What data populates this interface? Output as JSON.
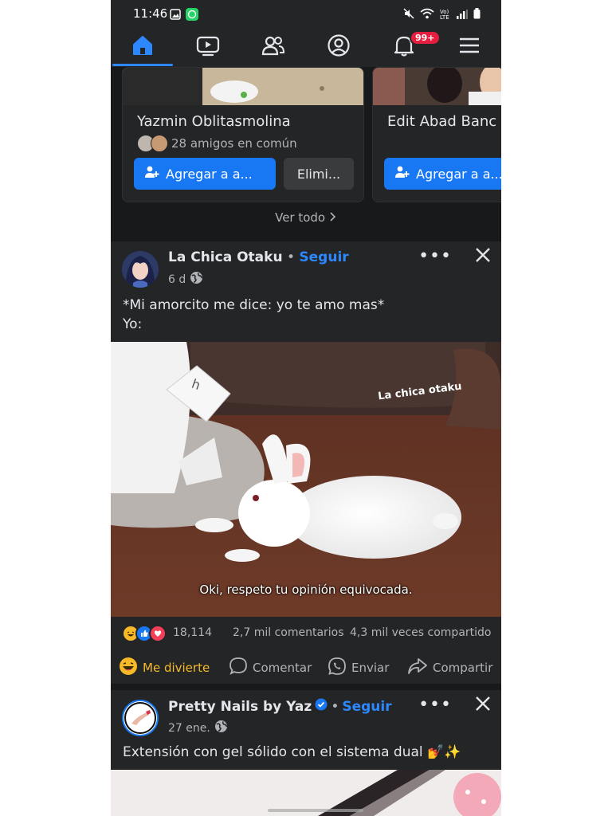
{
  "status_bar": {
    "time": "11:46",
    "network_label": "Vo) LTE"
  },
  "nav": {
    "tabs": [
      "home",
      "watch",
      "friends",
      "profile",
      "notifications",
      "menu"
    ],
    "notifications_badge": "99+"
  },
  "pymk": {
    "cards": [
      {
        "name": "Yazmin Oblitasmolina",
        "mutual": "28 amigos en común",
        "add_label": "Agregar a a...",
        "remove_label": "Elimi..."
      },
      {
        "name": "Edit Abad Banc",
        "add_label": "Agregar a a..."
      }
    ],
    "see_all": "Ver todo"
  },
  "post1": {
    "author": "La Chica Otaku",
    "separator": " • ",
    "follow": "Seguir",
    "time": "6 d",
    "text": "*Mi amorcito me dice: yo te amo mas*\nYo:",
    "image": {
      "watermark": "La chica otaku",
      "tag_letter": "h",
      "caption": "Oki, respeto tu opinión equivocada."
    },
    "reactions_count": "18,114",
    "comments": "2,7 mil comentarios",
    "shares": "4,3 mil veces compartido",
    "actions": {
      "react": "Me divierte",
      "comment": "Comentar",
      "send": "Enviar",
      "share": "Compartir"
    }
  },
  "post2": {
    "author": "Pretty Nails by Yaz",
    "separator": " • ",
    "follow": "Seguir",
    "time": "27 ene.",
    "text": "Extensión con gel sólido con el sistema dual 💅✨"
  },
  "colors": {
    "background": "#242526",
    "feed_separator": "#18191a",
    "accent_blue": "#1877f2",
    "link_blue": "#2d88ff",
    "haha_yellow": "#f7b928",
    "badge_red": "#e41e3f"
  }
}
